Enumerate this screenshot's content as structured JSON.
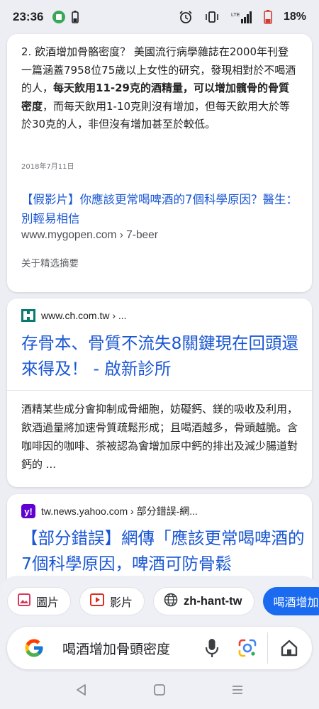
{
  "status_bar": {
    "time": "23:36",
    "battery": "18%",
    "network": "LTE"
  },
  "results": {
    "featured": {
      "snippet_parts": [
        {
          "text": "2. 飲酒增加骨骼密度？ 美國流行病學雜誌在2000年刊登一篇涵蓋7958位75歲以上女性的研究，發現相對於不喝酒的人，",
          "bold": false
        },
        {
          "text": "每天飲用11-29克的酒精量，可以增加髖骨的骨質密度",
          "bold": true
        },
        {
          "text": "，而每天飲用1-10克則沒有增加，但每天飲用大於等於30克的人，非但沒有增加甚至於較低。",
          "bold": false
        }
      ],
      "date": "2018年7月11日",
      "link_title": "【假影片】你應該更常喝啤酒的7個科學原因？醫生：別輕易相信",
      "url": "www.mygopen.com › 7-beer",
      "about_label": "关于精选摘要"
    },
    "result2": {
      "site": "www.ch.com.tw › ...",
      "title": "存骨本、骨質不流失8關鍵現在回頭還來得及！ - 啟新診所",
      "description": "酒精某些成分會抑制成骨細胞，妨礙鈣、鎂的吸收及利用，飲酒過量將加速骨質疏鬆形成；且喝酒越多，骨頭越脆。含咖啡因的咖啡、茶被認為會增加尿中鈣的排出及減少腸道對鈣的 ..."
    },
    "result3": {
      "favicon_letter": "y!",
      "site": "tw.news.yahoo.com › 部分錯誤-網...",
      "title": "【部分錯誤】網傳「應該更常喝啤酒的7個科學原因，啤酒可防骨鬆"
    }
  },
  "chips": [
    {
      "label": "圖片",
      "icon": "image-icon"
    },
    {
      "label": "影片",
      "icon": "video-icon"
    },
    {
      "label": "zh-hant-tw",
      "icon": "globe-icon"
    },
    {
      "label": "喝酒增加",
      "icon": ""
    }
  ],
  "search": {
    "query": "喝酒增加骨頭密度"
  },
  "colors": {
    "link_blue": "#1a57d3",
    "accent_chip": "#1a6bf0",
    "yahoo_purple": "#6001d2"
  }
}
